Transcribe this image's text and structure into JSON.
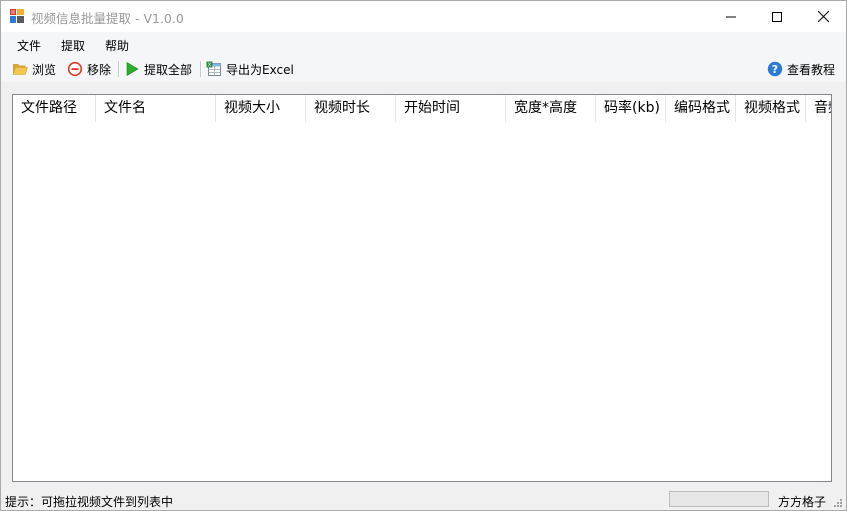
{
  "window": {
    "title": "视频信息批量提取 - V1.0.0"
  },
  "menu": {
    "items": [
      {
        "label": "文件"
      },
      {
        "label": "提取"
      },
      {
        "label": "帮助"
      }
    ]
  },
  "toolbar": {
    "browse_label": "浏览",
    "remove_label": "移除",
    "extract_all_label": "提取全部",
    "export_label": "导出为Excel",
    "help_label": "查看教程",
    "icons": {
      "browse": "folder-open-icon",
      "remove": "remove-circle-icon",
      "extract_all": "play-icon",
      "export": "excel-icon",
      "help": "help-circle-icon"
    }
  },
  "list": {
    "columns": [
      {
        "label": "文件路径"
      },
      {
        "label": "文件名"
      },
      {
        "label": "视频大小"
      },
      {
        "label": "视频时长"
      },
      {
        "label": "开始时间"
      },
      {
        "label": "宽度*高度"
      },
      {
        "label": "码率(kb)"
      },
      {
        "label": "编码格式"
      },
      {
        "label": "视频格式"
      },
      {
        "label": "音频"
      }
    ],
    "rows": []
  },
  "status": {
    "hint": "提示：可拖拉视频文件到列表中",
    "progress": 0,
    "author": "方方格子"
  },
  "colors": {
    "accent_play": "#2dae2d",
    "remove_red": "#d9382b",
    "help_blue": "#2b7bd6",
    "folder_yellow": "#e9b949"
  }
}
